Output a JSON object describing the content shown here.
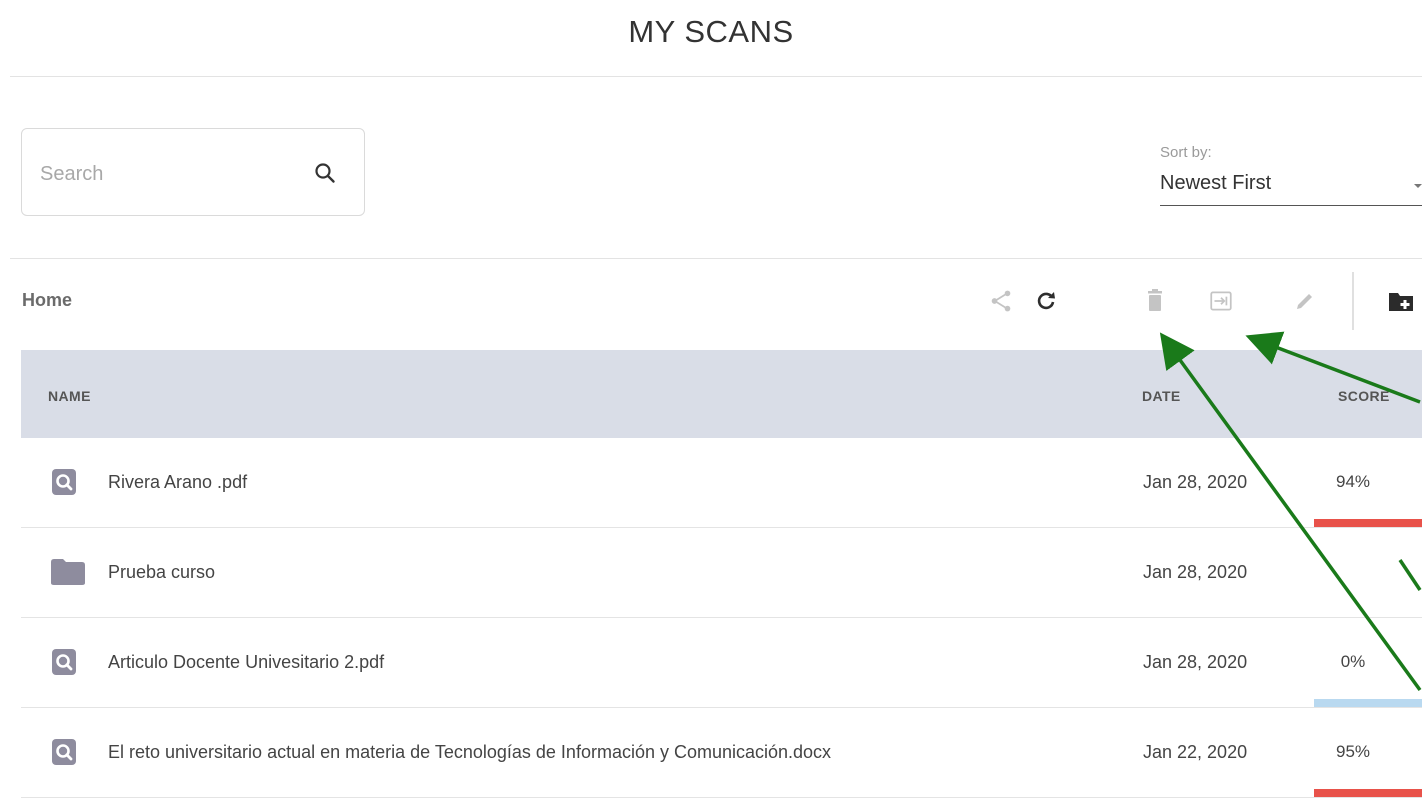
{
  "header": {
    "title": "MY SCANS"
  },
  "search": {
    "placeholder": "Search",
    "value": "",
    "icon": "search-icon"
  },
  "sort": {
    "label": "Sort by:",
    "value": "Newest First"
  },
  "breadcrumb": "Home",
  "toolbar": {
    "icons": [
      "share-icon",
      "refresh-icon",
      "delete-icon",
      "move-to-folder-icon",
      "rename-icon",
      "new-folder-icon"
    ]
  },
  "table": {
    "columns": {
      "name": "NAME",
      "date": "DATE",
      "score": "SCORE"
    },
    "rows": [
      {
        "name": "Rivera Arano .pdf",
        "type": "file",
        "date": "Jan 28, 2020",
        "score": "94%",
        "score_color": "#e8524a"
      },
      {
        "name": "Prueba curso",
        "type": "folder",
        "date": "Jan 28, 2020",
        "score": "",
        "score_color": ""
      },
      {
        "name": "Articulo Docente Univesitario 2.pdf",
        "type": "file",
        "date": "Jan 28, 2020",
        "score": "0%",
        "score_color": "#b9d9f0"
      },
      {
        "name": "El reto universitario actual en materia de Tecnologías de Información y Comunicación.docx",
        "type": "file",
        "date": "Jan 22, 2020",
        "score": "95%",
        "score_color": "#e8524a"
      }
    ]
  },
  "colors": {
    "header_bg": "#d9dde7",
    "icon_gray": "#8e8c9e",
    "annotation_arrow": "#1a7a1a",
    "high_score": "#e8524a",
    "low_score": "#b9d9f0"
  }
}
